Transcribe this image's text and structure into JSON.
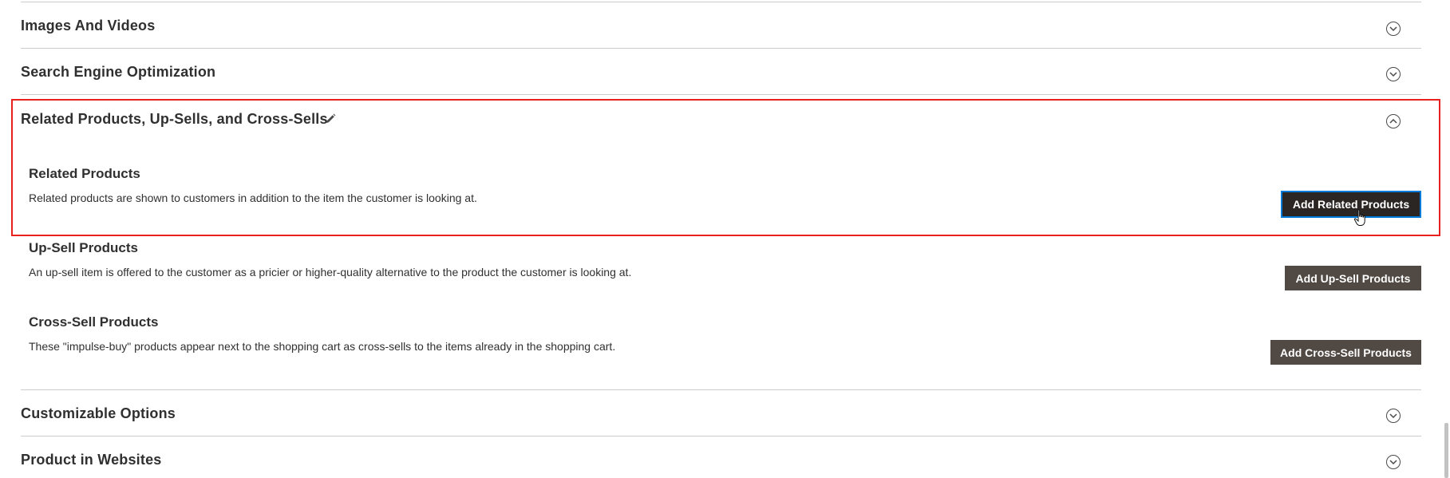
{
  "sections": {
    "images_videos": {
      "title": "Images And Videos"
    },
    "seo": {
      "title": "Search Engine Optimization"
    },
    "related": {
      "title": "Related Products, Up-Sells, and Cross-Sells",
      "blocks": [
        {
          "title": "Related Products",
          "description": "Related products are shown to customers in addition to the item the customer is looking at.",
          "button": "Add Related Products"
        },
        {
          "title": "Up-Sell Products",
          "description": "An up-sell item is offered to the customer as a pricier or higher-quality alternative to the product the customer is looking at.",
          "button": "Add Up-Sell Products"
        },
        {
          "title": "Cross-Sell Products",
          "description": "These \"impulse-buy\" products appear next to the shopping cart as cross-sells to the items already in the shopping cart.",
          "button": "Add Cross-Sell Products"
        }
      ]
    },
    "custom_options": {
      "title": "Customizable Options"
    },
    "websites": {
      "title": "Product in Websites"
    }
  },
  "icons": {
    "collapsed_toggle": "chevron-down-circle-icon",
    "expanded_toggle": "chevron-up-circle-icon",
    "edit": "pencil-icon",
    "cursor": "hand-pointer-icon"
  },
  "colors": {
    "button_bg": "#514943",
    "button_focused_bg": "#2b2624",
    "focus_border": "#007bdb",
    "highlight": "#e8201f",
    "divider": "#cccccc",
    "text": "#303030"
  }
}
